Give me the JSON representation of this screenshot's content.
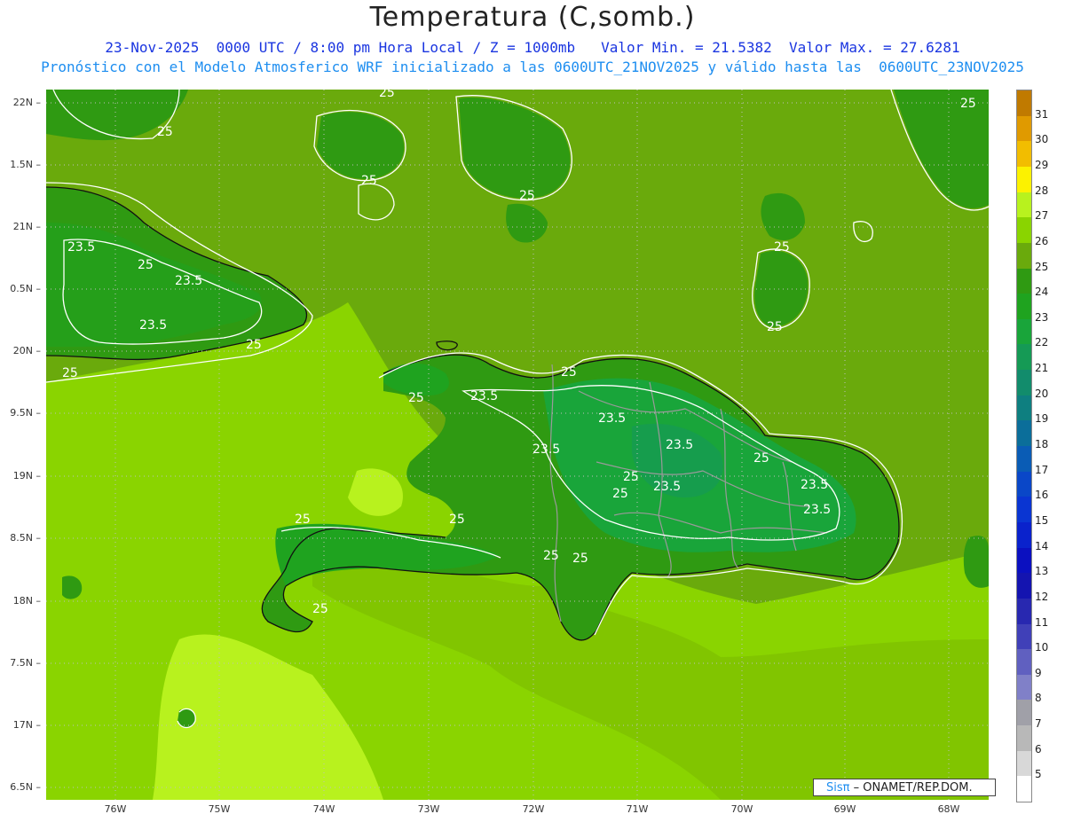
{
  "title": "Temperatura (C,somb.)",
  "subtitle1": "23-Nov-2025  0000 UTC / 8:00 pm Hora Local / Z = 1000mb   Valor Min. = 21.5382  Valor Max. = 27.6281",
  "subtitle2": "Pronóstico con el Modelo Atmosferico WRF inicializado a las 0600UTC_21NOV2025 y válido hasta las  0600UTC_23NOV2025",
  "credit_brand": "Sisπ",
  "credit_text": " – ONAMET/REP.DOM.",
  "lat_labels": [
    "22N",
    "1.5N",
    "21N",
    "0.5N",
    "20N",
    "9.5N",
    "19N",
    "8.5N",
    "18N",
    "7.5N",
    "17N",
    "6.5N"
  ],
  "lon_labels": [
    "76W",
    "75W",
    "74W",
    "73W",
    "72W",
    "71W",
    "70W",
    "69W",
    "68W"
  ],
  "contour_labels": [
    "25",
    "25",
    "25",
    "25",
    "25",
    "25",
    "25",
    "25",
    "25",
    "25",
    "25",
    "25",
    "25",
    "25",
    "25",
    "25",
    "25",
    "25",
    "25",
    "25",
    "23.5",
    "23.5",
    "23.5",
    "23.5",
    "23.5",
    "23.5",
    "23.5",
    "23.5",
    "23.5",
    "23.5"
  ],
  "scale": {
    "labels": [
      "31",
      "30",
      "29",
      "28",
      "27",
      "26",
      "25",
      "24",
      "23",
      "22",
      "21",
      "20",
      "19",
      "18",
      "17",
      "16",
      "15",
      "14",
      "13",
      "12",
      "11",
      "10",
      "9",
      "8",
      "7",
      "6",
      "5"
    ],
    "colors": [
      "#c07a00",
      "#e09a00",
      "#f2bd00",
      "#fcf200",
      "#b8f21e",
      "#8ad400",
      "#6aaa0c",
      "#2f9a12",
      "#1fa31f",
      "#19a53a",
      "#159a55",
      "#128c6c",
      "#0e7f80",
      "#0b6e9a",
      "#0a5cb5",
      "#0a47c8",
      "#0a35d2",
      "#0a22cc",
      "#0b10c0",
      "#1414b0",
      "#2828b0",
      "#4040b8",
      "#6060c0",
      "#8080c8",
      "#a0a0a8",
      "#b8b8b8",
      "#d8d8d8",
      "#ffffff"
    ]
  },
  "legend_colors": {
    "land_high": "#2f9a12",
    "sea_mid": "#6aaa0c",
    "sea_warm": "#8ad400",
    "sea_hot": "#b8f21e"
  }
}
